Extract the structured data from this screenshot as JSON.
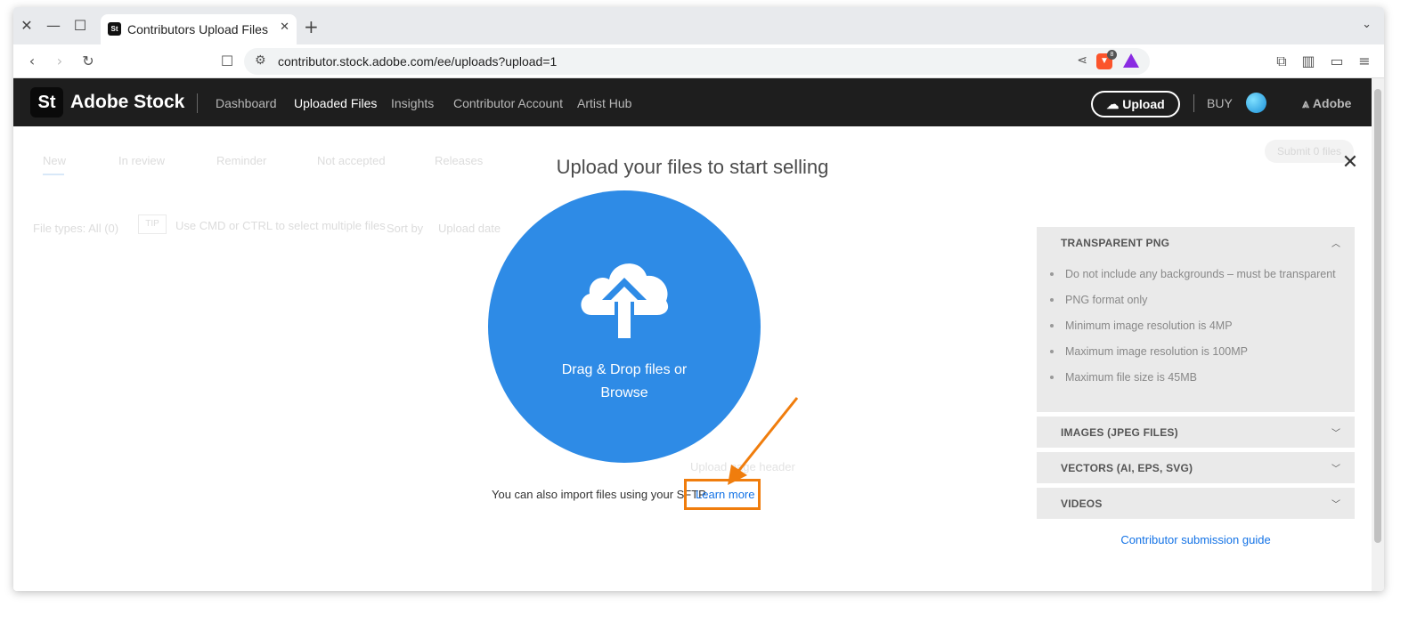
{
  "browser": {
    "tab_title": "Contributors Upload Files",
    "favicon_text": "St",
    "url": "contributor.stock.adobe.com/ee/uploads?upload=1",
    "brave_badge_count": "8"
  },
  "header": {
    "logo_text": "St",
    "brand": "Adobe Stock",
    "nav": [
      "Dashboard",
      "Uploaded Files",
      "Insights",
      "Contributor Account",
      "Artist Hub"
    ],
    "active_nav": "Uploaded Files",
    "upload_label": "Upload",
    "buy_label": "BUY",
    "adobe_label": "Adobe"
  },
  "background": {
    "tabs": [
      "New",
      "In review",
      "Reminder",
      "Not accepted",
      "Releases"
    ],
    "file_types": "File types: All (0)",
    "tip": "TIP",
    "tip_text": "Use CMD or CTRL to select multiple files",
    "sort_by": "Sort by",
    "sort_value": "Upload date",
    "submit_label": "Submit 0 files",
    "behind_text": "Upload page header"
  },
  "modal": {
    "title": "Upload your files to start selling",
    "drop_line1": "Drag & Drop files or",
    "drop_line2": "Browse",
    "sftp_text": "You can also import files using your SFTP.",
    "learn_more": "Learn more",
    "accordion": {
      "open_title": "TRANSPARENT PNG",
      "open_items": [
        "Do not include any backgrounds – must be transparent",
        "PNG format only",
        "Minimum image resolution is 4MP",
        "Maximum image resolution is 100MP",
        "Maximum file size is 45MB"
      ],
      "sections": [
        "IMAGES (JPEG FILES)",
        "VECTORS (AI, EPS, SVG)",
        "VIDEOS"
      ]
    },
    "guide_link": "Contributor submission guide"
  },
  "colors": {
    "accent_blue": "#2e8be6",
    "link_blue": "#1473e6",
    "annotation_orange": "#f07d0d",
    "header_bg": "#1e1e1e"
  },
  "icons": {
    "upload": "cloud-upload-icon",
    "close": "close-icon",
    "chevron_up": "chevron-up-icon",
    "chevron_down": "chevron-down-icon"
  }
}
